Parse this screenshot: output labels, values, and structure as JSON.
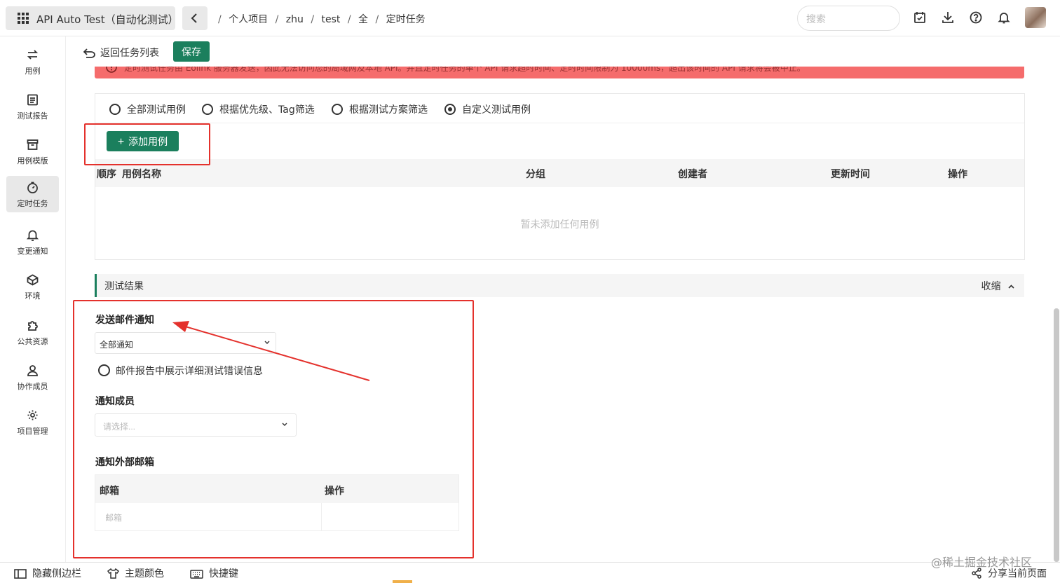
{
  "app": {
    "title": "API Auto Test（自动化测试）"
  },
  "breadcrumb": [
    "/",
    "个人项目",
    "/",
    "zhu",
    "/",
    "test",
    "/",
    "全",
    "/",
    "定时任务"
  ],
  "search": {
    "placeholder": "搜索"
  },
  "sidebar": {
    "items": [
      {
        "label": "用例",
        "icon": "cases-icon"
      },
      {
        "label": "测试报告",
        "icon": "report-icon"
      },
      {
        "label": "用例模版",
        "icon": "template-icon"
      },
      {
        "label": "定时任务",
        "icon": "timer-icon",
        "active": true
      },
      {
        "label": "变更通知",
        "icon": "bell-icon"
      },
      {
        "label": "环境",
        "icon": "environment-icon"
      },
      {
        "label": "公共资源",
        "icon": "puzzle-icon"
      },
      {
        "label": "协作成员",
        "icon": "members-icon"
      },
      {
        "label": "项目管理",
        "icon": "gear-icon"
      }
    ]
  },
  "actions": {
    "back_label": "返回任务列表",
    "save_label": "保存"
  },
  "alert": {
    "text": "定时测试任务由 Eolink 服务器发送，因此无法访问您的局域网及本地 API。并且定时任务的单个 API 请求超时时间、定时时间限制为 10000ms，超出该时间的 API 请求将会被中止。"
  },
  "filters": {
    "options": [
      "全部测试用例",
      "根据优先级、Tag筛选",
      "根据测试方案筛选",
      "自定义测试用例"
    ],
    "selected": "自定义测试用例"
  },
  "cases": {
    "add_label": "添加用例",
    "columns": [
      "顺序",
      "用例名称",
      "分组",
      "创建者",
      "更新时间",
      "操作"
    ],
    "empty_text": "暂未添加任何用例"
  },
  "result": {
    "title": "测试结果",
    "collapse_label": "收缩"
  },
  "email": {
    "section_title": "发送邮件通知",
    "notify_value": "全部通知",
    "detail_checkbox_label": "邮件报告中展示详细测试错误信息",
    "members_title": "通知成员",
    "members_placeholder": "请选择...",
    "external_title": "通知外部邮箱",
    "table_columns": [
      "邮箱",
      "操作"
    ],
    "email_placeholder": "邮箱"
  },
  "bottom": {
    "hide_sidebar": "隐藏侧边栏",
    "theme": "主题颜色",
    "shortcuts": "快捷键",
    "share": "分享当前页面"
  },
  "watermark": "@稀土掘金技术社区",
  "colors": {
    "primary": "#1b7f5d",
    "alert": "#f56c6c",
    "annotation": "#e4312c"
  }
}
